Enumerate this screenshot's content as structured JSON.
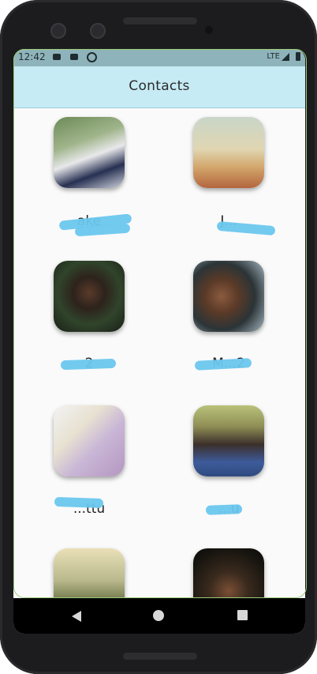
{
  "status_bar": {
    "time": "12:42",
    "network": "LTE"
  },
  "app_bar": {
    "title": "Contacts"
  },
  "contacts": [
    {
      "name": "",
      "visible_name_fragment": "ake"
    },
    {
      "name": "",
      "visible_name_fragment": "J..."
    },
    {
      "name": "",
      "visible_name_fragment": "2"
    },
    {
      "name": "",
      "visible_name_fragment": "M...2"
    },
    {
      "name": "",
      "visible_name_fragment": "...ttu"
    },
    {
      "name": "",
      "visible_name_fragment": "...u"
    },
    {
      "name": "",
      "visible_name_fragment": ""
    },
    {
      "name": "",
      "visible_name_fragment": ""
    }
  ],
  "colors": {
    "app_bar": "#c6ebf4",
    "status_bar": "#8fb3ba",
    "redaction": "#6ac7ee"
  },
  "icons": [
    "youtube-icon",
    "youtube-icon",
    "data-saver-icon",
    "signal-icon",
    "battery-icon",
    "back-icon",
    "home-icon",
    "recents-icon"
  ]
}
